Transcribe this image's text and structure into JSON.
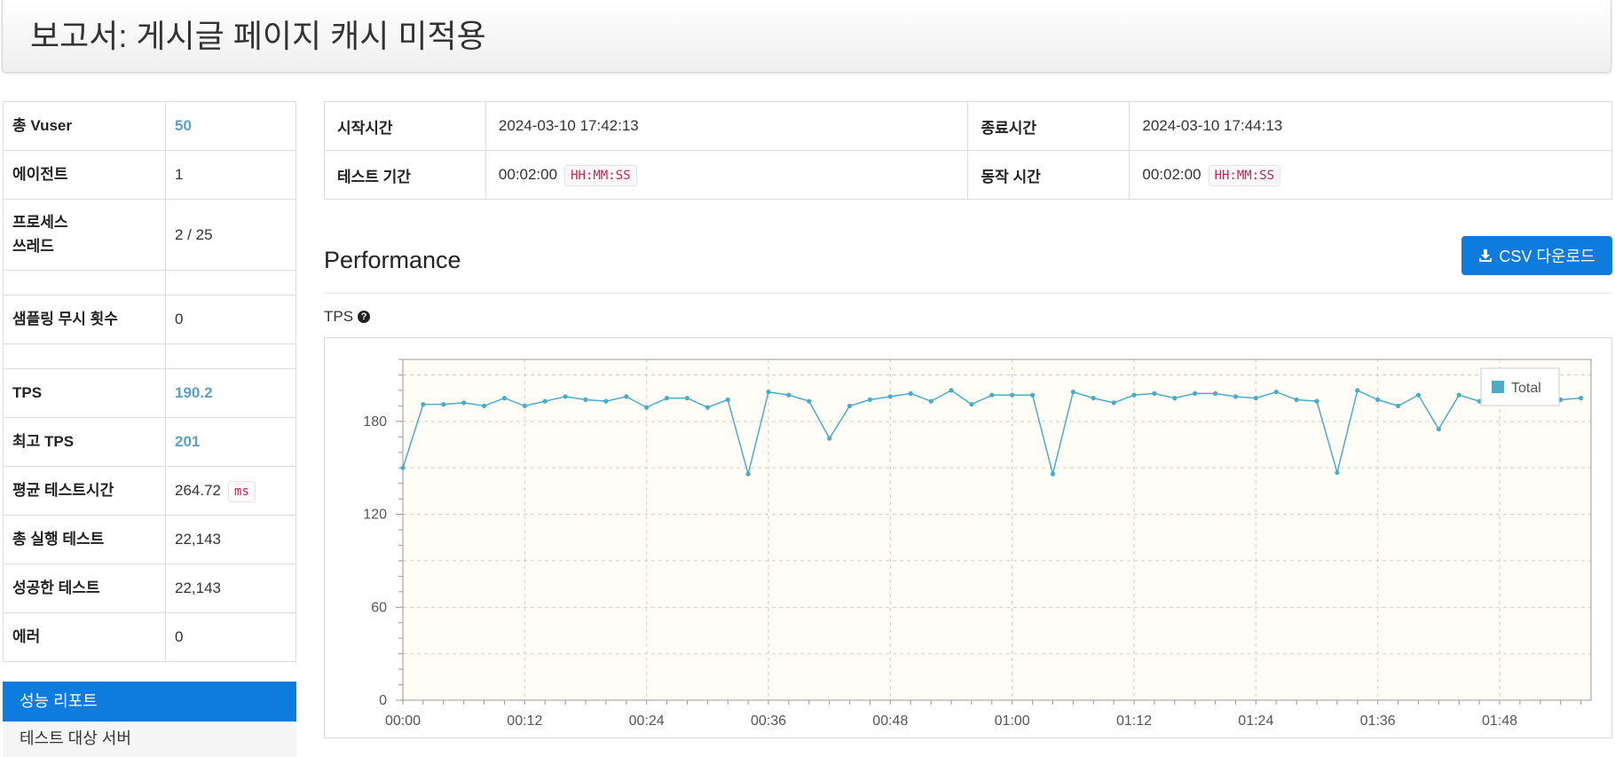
{
  "header": {
    "title": "보고서: 게시글 페이지 캐시 미적용"
  },
  "summary": {
    "total_vuser_label": "총 Vuser",
    "total_vuser": "50",
    "agent_label": "에이전트",
    "agent": "1",
    "process_label_line1": "프로세스",
    "process_label_line2": "쓰레드",
    "process": "2 / 25",
    "ignore_count_label": "샘플링 무시 횟수",
    "ignore_count": "0",
    "tps_label": "TPS",
    "tps": "190.2",
    "peak_tps_label": "최고 TPS",
    "peak_tps": "201",
    "avg_time_label": "평균 테스트시간",
    "avg_time": "264.72",
    "avg_time_unit": "ms",
    "total_tests_label": "총 실행 테스트",
    "total_tests": "22,143",
    "success_label": "성공한 테스트",
    "success": "22,143",
    "error_label": "에러",
    "error": "0"
  },
  "menu": {
    "items": [
      "성능 리포트",
      "테스트 대상 서버"
    ]
  },
  "info": {
    "start_label": "시작시간",
    "start": "2024-03-10 17:42:13",
    "end_label": "종료시간",
    "end": "2024-03-10 17:44:13",
    "duration_label": "테스트 기간",
    "duration": "00:02:00",
    "duration_unit": "HH:MM:SS",
    "run_label": "동작 시간",
    "run": "00:02:00",
    "run_unit": "HH:MM:SS"
  },
  "performance": {
    "title": "Performance",
    "csv_label": "CSV 다운로드",
    "tps_chart_label": "TPS"
  },
  "chart_data": {
    "type": "line",
    "series": [
      {
        "name": "Total",
        "color": "#4bacc6",
        "values": [
          150,
          191,
          191,
          192,
          190,
          195,
          190,
          193,
          196,
          194,
          193,
          196,
          189,
          195,
          195,
          189,
          194,
          146,
          199,
          197,
          193,
          169,
          190,
          194,
          196,
          198,
          193,
          200,
          191,
          197,
          197,
          197,
          146,
          199,
          195,
          192,
          197,
          198,
          195,
          198,
          198,
          196,
          195,
          199,
          194,
          193,
          147,
          200,
          194,
          190,
          197,
          175,
          197,
          193,
          194,
          195,
          195,
          194,
          195
        ]
      }
    ],
    "x": [
      "00:00",
      "00:02",
      "00:04",
      "00:06",
      "00:08",
      "00:10",
      "00:12",
      "00:14",
      "00:16",
      "00:18",
      "00:20",
      "00:22",
      "00:24",
      "00:26",
      "00:28",
      "00:30",
      "00:32",
      "00:34",
      "00:36",
      "00:38",
      "00:40",
      "00:42",
      "00:44",
      "00:46",
      "00:48",
      "00:50",
      "00:52",
      "00:54",
      "00:56",
      "00:58",
      "01:00",
      "01:02",
      "01:04",
      "01:06",
      "01:08",
      "01:10",
      "01:12",
      "01:14",
      "01:16",
      "01:18",
      "01:20",
      "01:22",
      "01:24",
      "01:26",
      "01:28",
      "01:30",
      "01:32",
      "01:34",
      "01:36",
      "01:38",
      "01:40",
      "01:42",
      "01:44",
      "01:46",
      "01:48",
      "01:50",
      "01:52",
      "01:54",
      "01:56"
    ],
    "x_tick_labels": [
      "00:00",
      "00:12",
      "00:24",
      "00:36",
      "00:48",
      "01:00",
      "01:12",
      "01:24",
      "01:36",
      "01:48"
    ],
    "y_tick_labels": [
      "0",
      "60",
      "120",
      "180"
    ],
    "ylim": [
      0,
      220
    ],
    "grid": true,
    "legend": "top-right",
    "plot_background": "#fffdf5"
  }
}
